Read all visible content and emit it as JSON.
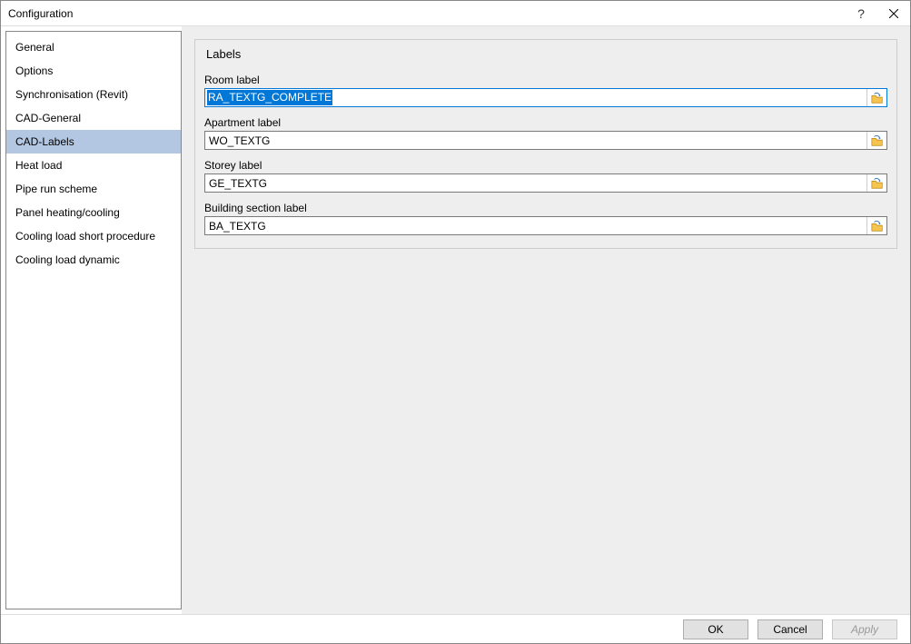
{
  "window": {
    "title": "Configuration"
  },
  "sidebar": {
    "items": [
      {
        "label": "General"
      },
      {
        "label": "Options"
      },
      {
        "label": "Synchronisation (Revit)"
      },
      {
        "label": "CAD-General"
      },
      {
        "label": "CAD-Labels",
        "selected": true
      },
      {
        "label": "Heat load"
      },
      {
        "label": "Pipe run scheme"
      },
      {
        "label": "Panel heating/cooling"
      },
      {
        "label": "Cooling load short procedure"
      },
      {
        "label": "Cooling load dynamic"
      }
    ]
  },
  "panel": {
    "title": "Labels",
    "fields": {
      "room": {
        "label": "Room label",
        "value": "RA_TEXTG_COMPLETE",
        "focused": true
      },
      "apartment": {
        "label": "Apartment label",
        "value": "WO_TEXTG"
      },
      "storey": {
        "label": "Storey label",
        "value": "GE_TEXTG"
      },
      "building_section": {
        "label": "Building section label",
        "value": "BA_TEXTG"
      }
    }
  },
  "footer": {
    "ok": "OK",
    "cancel": "Cancel",
    "apply": "Apply"
  }
}
